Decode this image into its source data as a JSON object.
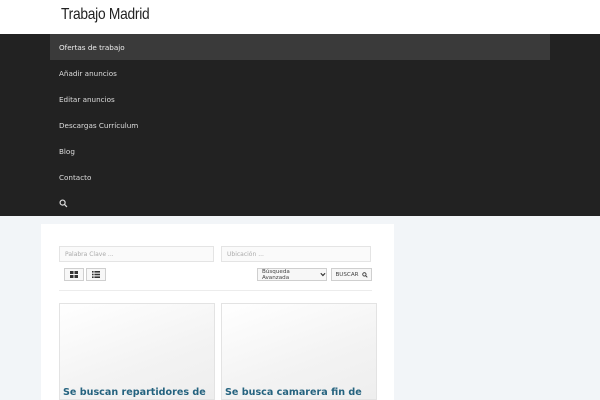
{
  "site": {
    "title": "Trabajo Madrid"
  },
  "nav": {
    "items": [
      {
        "label": "Ofertas de trabajo"
      },
      {
        "label": "Añadir anuncios"
      },
      {
        "label": "Editar anuncios"
      },
      {
        "label": "Descargas Currículum"
      },
      {
        "label": "Blog"
      },
      {
        "label": "Contacto"
      }
    ],
    "search_icon": "search-icon"
  },
  "search": {
    "keyword_placeholder": "Palabra Clave ...",
    "location_placeholder": "Ubicación ...",
    "advanced_label": "Búsqueda Avanzada",
    "submit_label": "BUSCAR"
  },
  "view": {
    "grid_icon": "grid-view-icon",
    "list_icon": "list-view-icon"
  },
  "listings": [
    {
      "title": "Se buscan repartidores de"
    },
    {
      "title": "Se busca camarera fin de"
    }
  ],
  "colors": {
    "nav_bg": "#222222",
    "active_bg": "#3a3a3a",
    "link": "#25637f",
    "content_bg": "#f2f5f8"
  }
}
